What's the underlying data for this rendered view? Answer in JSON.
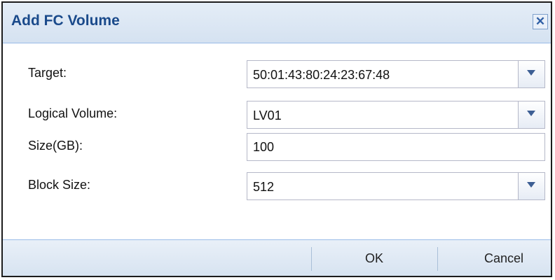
{
  "dialog": {
    "title": "Add FC Volume",
    "close_glyph": "✕"
  },
  "form": {
    "target": {
      "label": "Target:",
      "value": "50:01:43:80:24:23:67:48"
    },
    "logical_volume": {
      "label": "Logical Volume:",
      "value": "LV01"
    },
    "size": {
      "label": "Size(GB):",
      "value": "100"
    },
    "block_size": {
      "label": "Block Size:",
      "value": "512"
    }
  },
  "footer": {
    "ok_label": "OK",
    "cancel_label": "Cancel"
  },
  "icons": {
    "close": "close-icon",
    "dropdown": "chevron-down-icon"
  },
  "colors": {
    "title_text": "#1a4a8b",
    "header_bg": "#dbe6f3",
    "field_border": "#b5b8c8"
  }
}
